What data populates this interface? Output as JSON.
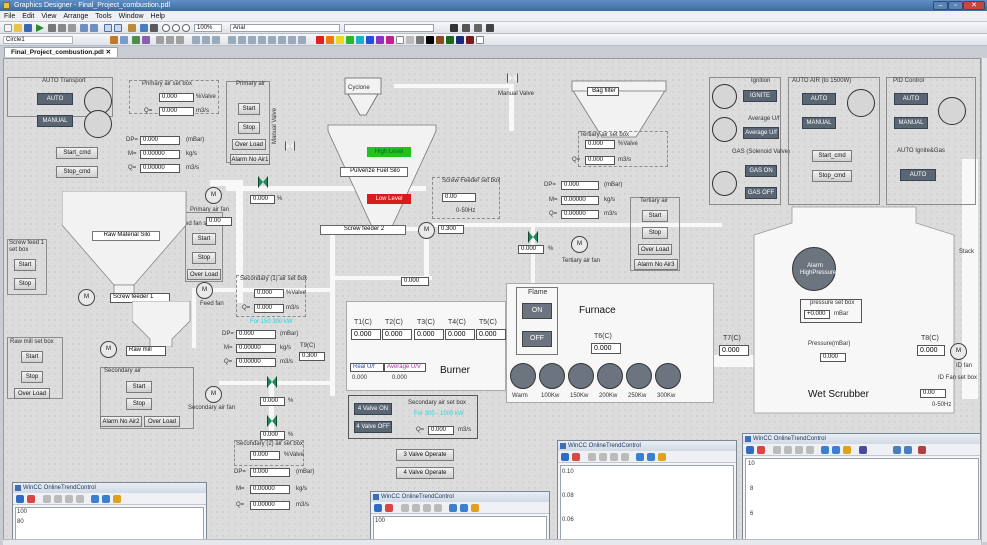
{
  "window": {
    "title": "Graphics Designer - Final_Project_combustion.pdl",
    "minimize": "–",
    "maximize": "▫",
    "close": "✕"
  },
  "menu": [
    "File",
    "Edit",
    "View",
    "Arrange",
    "Tools",
    "Window",
    "Help"
  ],
  "toolbar": {
    "zoom": "100%",
    "font": "Arial",
    "object_name": "Circle1"
  },
  "doc_tab": "Final_Project_combustion.pdl ✕",
  "left": {
    "auto_transport": "AUTO Transport",
    "auto": "AUTO",
    "manual": "MANUAL",
    "start_cmd": "Start_cmd",
    "stop_cmd": "Stop_cmd",
    "primary_air_set": "Primary air set box",
    "pct_value": "0.000",
    "pct_unit": "%Valve",
    "q_label": "Q=",
    "q_value": "0.000",
    "q_unit": "m3/s",
    "dp_label": "DP=",
    "dp_value": "0.000",
    "dp_unit": "(mBar)",
    "m_label": "M=",
    "m_value": "0.00000",
    "m_unit": "kg/s",
    "q2_label": "Q=",
    "q2_value": "0.00000",
    "q2_unit": "m3/s",
    "primary_air": "Primary air",
    "start": "Start",
    "stop": "Stop",
    "over_load": "Over Load",
    "alarm_no_air1": "Alarm No Air1",
    "main_valve": "Manual Valve",
    "primary_fan_value": "0.000",
    "primary_fan_unit": "%",
    "primary_air_fan": "Primary air fan",
    "feed_fan_set": "Feed fan set box",
    "feed_fan_value": "0.00",
    "feed_start": "Start",
    "feed_stop": "Stop",
    "feed_over_load": "Over Load",
    "feed_fan": "Feed fan",
    "screw_feed_set": "Screw feed 1 set box",
    "screw_start": "Start",
    "screw_stop": "Stop",
    "raw_material_silo": "Raw Material Silo",
    "screw_feeder1": "Screw feeder 1",
    "raw_mill_set": "Raw mill set box",
    "raw_start": "Start",
    "raw_stop": "Stop",
    "raw_over_load": "Over Load",
    "raw_mill": "Raw mill",
    "secondary_air": "Secondary air",
    "sec_start": "Start",
    "sec_stop": "Stop",
    "alarm_no_air2": "Alarm No Air2",
    "over_load2": "Over Load",
    "secondary1_set": "Secondary (1) air set box",
    "sec1_pct": "0.000",
    "sec1_unit": "%Valve",
    "sec1_q": "0.000",
    "sec1_q_unit": "m3/s",
    "sec1_range": "For 150 300 kW",
    "sec_dp": "0.000",
    "sec_m": "0.00000",
    "sec_q": "0.00000",
    "t9_label": "T9(C)",
    "t9_value": "0.300",
    "secondary_air_fan": "Secondary air fan",
    "sec_fan_value": "0.000",
    "sec_fan_unit": "%",
    "sec_valve_value": "0.000",
    "secondary2_set": "Secondary (2) air set box",
    "sec2_pct": "0.000",
    "sec2_unit": "%Valve",
    "sec2_dp": "0.000",
    "sec2_m": "0.00000",
    "sec2_q": "0.00000",
    "motor": "M"
  },
  "center": {
    "cyclone": "Cyclone",
    "manual_valve": "Manual Valve",
    "bag_filter": "Bag filter",
    "high_level": "High Level",
    "low_level": "Low Level",
    "pulverize_silo": "Pulverize Fuel Silo",
    "screw_feeder2": "Screw feeder 2",
    "screw_feed_set2": "Screw Feeder set box",
    "screw_value": "0.00",
    "screw_hz": "0-50Hz",
    "screw_motor_value": "0.300",
    "tertiary_set": "Tertiary air set box",
    "tert_pct": "0.000",
    "tert_unit": "%Valve",
    "tert_q": "0.000",
    "tert_q_unit": "m3/s",
    "tert_dp": "0.000",
    "tert_m": "0.00000",
    "tert_q2": "0.00000",
    "tertiary_air": "Tertiary air",
    "tert_start": "Start",
    "tert_stop": "Stop",
    "tert_over_load": "Over Load",
    "alarm_no_air3": "Alarm No Air3",
    "tert_fan_value": "0.000",
    "tert_fan_unit": "%",
    "tertiary_air_fan": "Tertiary air fan",
    "duct_value": "0.000",
    "t_labels": [
      "T1(C)",
      "T2(C)",
      "T3(C)",
      "T4(C)",
      "T5(C)"
    ],
    "t_values": [
      "0.000",
      "0.000",
      "0.000",
      "0.000",
      "0.000"
    ],
    "real_uf": "Real U/f",
    "average_uv": "Average U/V",
    "real_uf_value": "0.000",
    "average_uv_value": "0.000",
    "burner": "Burner",
    "valve_on": "4 Valve ON",
    "valve_off": "4 Valve OFF",
    "sec_air_set": "Secondary air set box",
    "sec_air_range": "For 300 - 1000 kW",
    "sec_air_q_value": "0.000",
    "sec_air_q_unit": "m3/s",
    "three_valve": "3 Valve Operate",
    "four_valve": "4 Valve Operate",
    "flame": "Flame",
    "flame_on": "ON",
    "flame_off": "OFF",
    "furnace": "Furnace",
    "t6_label": "T6(C)",
    "t6_value": "0.000",
    "warm": "Warm",
    "kw_labels": [
      "100Kw",
      "150Kw",
      "200Kw",
      "250Kw",
      "300Kw"
    ],
    "t7_label": "T7(C)",
    "t7_value": "0.000"
  },
  "right": {
    "ignition": "Ignition",
    "ignite": "IGNITE",
    "average_uf_label": "Average U/f",
    "average_uf_btn": "Average U/f",
    "gas_valve": "GAS (Solenoid Valve)",
    "gas_on": "GAS ON",
    "gas_off": "GAS OFF",
    "auto_air": "AUTO AIR (to 1500W)",
    "auto": "AUTO",
    "manual": "MANUAL",
    "start_cmd": "Start_cmd",
    "stop_cmd": "Stop_cmd",
    "pid_control": "PID Control",
    "pid_auto": "AUTO",
    "pid_manual": "MANUAL",
    "auto_ignite_gas": "AUTO Ignite&Gas",
    "auto2": "AUTO",
    "alarm_high_pressure": "Alarm HighPressure",
    "pressure_set": "pressure set box",
    "pressure_value": "+0.000",
    "pressure_unit": "mBar",
    "pressure_label": "Pressure(mBar)",
    "pressure_reading": "0.000",
    "wet_scrubber": "Wet Scrubber",
    "stack": "Stack",
    "t8_label": "T8(C)",
    "t8_value": "0.000",
    "id_fan": "ID fan",
    "id_fan_set": "ID Fan set box",
    "id_fan_value": "0.00",
    "id_fan_hz": "0-50Hz"
  },
  "trends": [
    {
      "title": "WinCC OnlineTrendControl",
      "yticks": [
        "100",
        "80"
      ]
    },
    {
      "title": "WinCC OnlineTrendControl",
      "yticks": [
        "100"
      ]
    },
    {
      "title": "WinCC OnlineTrendControl",
      "yticks": [
        "0.10",
        "0.08",
        "0.06"
      ]
    },
    {
      "title": "WinCC OnlineTrendControl",
      "yticks": [
        "10",
        "8",
        "6"
      ]
    }
  ],
  "colors": {
    "high_level": "#22c21a",
    "low_level": "#d91a1a",
    "accent_cyan": "#2ad3d9",
    "dark_button": "#5a6673"
  }
}
